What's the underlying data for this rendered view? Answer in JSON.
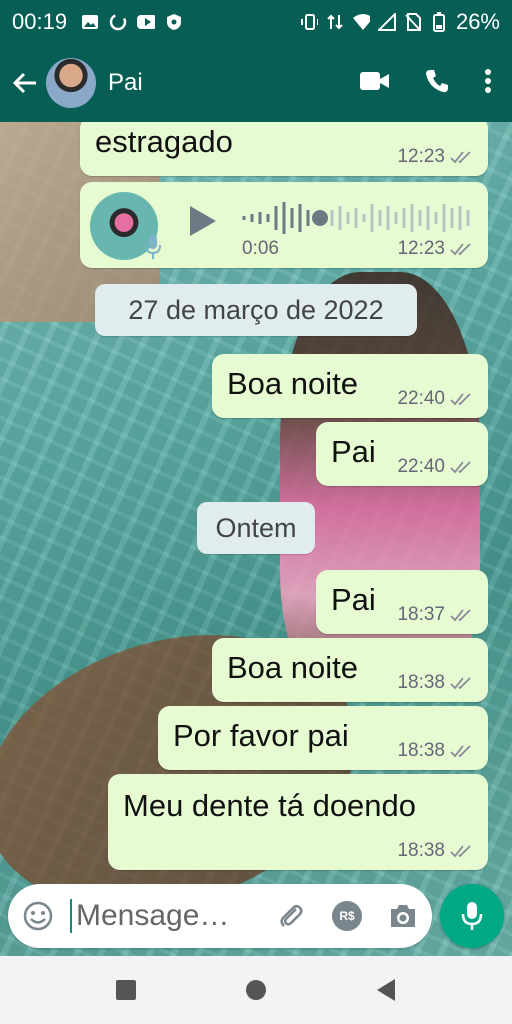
{
  "status_bar": {
    "time": "00:19",
    "battery": "26%"
  },
  "header": {
    "back_icon": "arrow-left-icon",
    "contact_name": "Pai",
    "actions": [
      "video-call-icon",
      "phone-icon",
      "more-vertical-icon"
    ]
  },
  "messages": {
    "m1": {
      "text": "estragado",
      "time": "12:23"
    },
    "audio": {
      "duration": "0:06",
      "time": "12:23"
    },
    "date1": "27 de março de 2022",
    "m2": {
      "text": "Boa noite",
      "time": "22:40"
    },
    "m3": {
      "text": "Pai",
      "time": "22:40"
    },
    "date2": "Ontem",
    "m4": {
      "text": "Pai",
      "time": "18:37"
    },
    "m5": {
      "text": "Boa noite",
      "time": "18:38"
    },
    "m6": {
      "text": "Por favor pai",
      "time": "18:38"
    },
    "m7": {
      "text": "Meu dente tá doendo",
      "time": "18:38"
    }
  },
  "composer": {
    "placeholder": "Mensage…",
    "icons": [
      "emoji-icon",
      "attach-icon",
      "payment-icon",
      "camera-icon",
      "mic-icon"
    ],
    "currency_label": "R$"
  },
  "colors": {
    "header": "#075e54",
    "bubble": "#e7fbd3",
    "accent": "#00a884"
  }
}
